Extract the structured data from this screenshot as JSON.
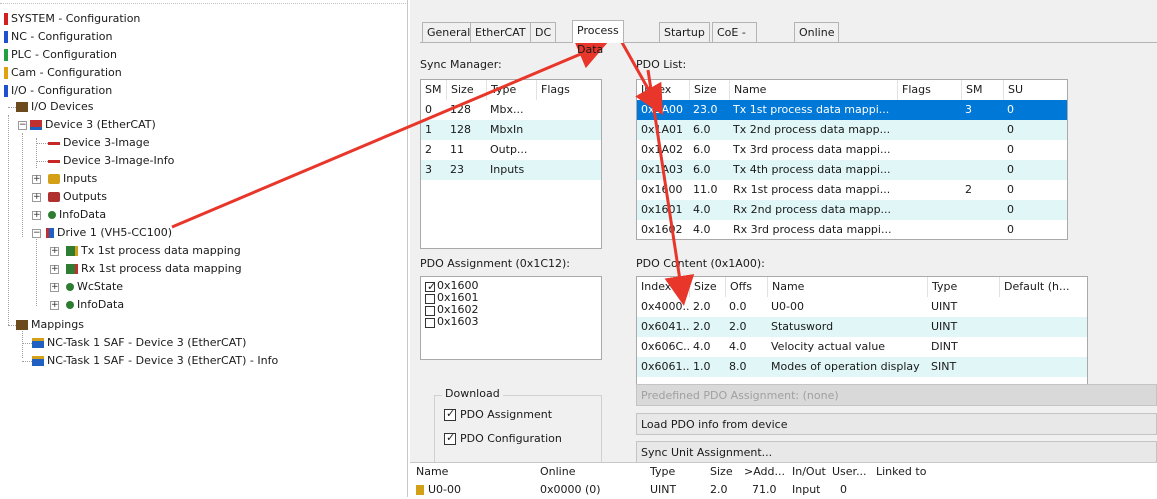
{
  "tree": {
    "items": [
      {
        "label": "SYSTEM - Configuration",
        "icon": "system-config-icon"
      },
      {
        "label": "NC - Configuration",
        "icon": "nc-config-icon"
      },
      {
        "label": "PLC - Configuration",
        "icon": "plc-config-icon"
      },
      {
        "label": "Cam - Configuration",
        "icon": "cam-config-icon"
      },
      {
        "label": "I/O - Configuration",
        "icon": "io-config-icon"
      },
      {
        "label": "I/O Devices",
        "icon": "io-devices-icon"
      },
      {
        "label": "Device 3 (EtherCAT)",
        "icon": "ethercat-device-icon"
      },
      {
        "label": "Device 3-Image",
        "icon": "image-icon"
      },
      {
        "label": "Device 3-Image-Info",
        "icon": "image-info-icon"
      },
      {
        "label": "Inputs",
        "icon": "inputs-icon"
      },
      {
        "label": "Outputs",
        "icon": "outputs-icon"
      },
      {
        "label": "InfoData",
        "icon": "infodata-icon"
      },
      {
        "label": "Drive 1 (VH5-CC100)",
        "icon": "drive-icon"
      },
      {
        "label": "Tx 1st  process data mapping",
        "icon": "tx-mapping-icon"
      },
      {
        "label": "Rx 1st process data mapping",
        "icon": "rx-mapping-icon"
      },
      {
        "label": "WcState",
        "icon": "wcstate-icon"
      },
      {
        "label": "InfoData",
        "icon": "infodata-icon"
      },
      {
        "label": "Mappings",
        "icon": "mappings-icon"
      },
      {
        "label": "NC-Task 1 SAF - Device 3 (EtherCAT)",
        "icon": "task-mapping-icon"
      },
      {
        "label": "NC-Task 1 SAF - Device 3 (EtherCAT) - Info",
        "icon": "task-mapping-icon"
      }
    ]
  },
  "tabs": [
    "General",
    "EtherCAT",
    "DC",
    "Process Data",
    "Startup",
    "CoE - Online",
    "Online"
  ],
  "active_tab": "Process Data",
  "sync_manager": {
    "title": "Sync Manager:",
    "columns": [
      "SM",
      "Size",
      "Type",
      "Flags"
    ],
    "rows": [
      [
        "0",
        "128",
        "Mbx...",
        ""
      ],
      [
        "1",
        "128",
        "MbxIn",
        ""
      ],
      [
        "2",
        "11",
        "Outp...",
        ""
      ],
      [
        "3",
        "23",
        "Inputs",
        ""
      ]
    ]
  },
  "pdo_list": {
    "title": "PDO List:",
    "columns": [
      "Index",
      "Size",
      "Name",
      "Flags",
      "SM",
      "SU"
    ],
    "rows": [
      [
        "0x1A00",
        "23.0",
        "Tx 1st  process data mappi...",
        "",
        "3",
        "0"
      ],
      [
        "0x1A01",
        "6.0",
        "Tx 2nd process data mapp...",
        "",
        "",
        "0"
      ],
      [
        "0x1A02",
        "6.0",
        "Tx 3rd process data mappi...",
        "",
        "",
        "0"
      ],
      [
        "0x1A03",
        "6.0",
        "Tx 4th process data mappi...",
        "",
        "",
        "0"
      ],
      [
        "0x1600",
        "11.0",
        "Rx 1st process data mappi...",
        "",
        "2",
        "0"
      ],
      [
        "0x1601",
        "4.0",
        "Rx 2nd process data mapp...",
        "",
        "",
        "0"
      ],
      [
        "0x1602",
        "4.0",
        "Rx 3rd process data mappi...",
        "",
        "",
        "0"
      ],
      [
        "0x1603",
        "4.0",
        "Rx 4th process data mappi...",
        "",
        "",
        "0"
      ]
    ]
  },
  "pdo_assignment": {
    "title": "PDO Assignment (0x1C12):",
    "items": [
      {
        "label": "0x1600",
        "checked": true
      },
      {
        "label": "0x1601",
        "checked": false
      },
      {
        "label": "0x1602",
        "checked": false
      },
      {
        "label": "0x1603",
        "checked": false
      }
    ]
  },
  "pdo_content": {
    "title": "PDO Content (0x1A00):",
    "columns": [
      "Index",
      "Size",
      "Offs",
      "Name",
      "Type",
      "Default (h..."
    ],
    "rows": [
      [
        "0x4000...",
        "2.0",
        "0.0",
        "U0-00",
        "UINT",
        ""
      ],
      [
        "0x6041...",
        "2.0",
        "2.0",
        "Statusword",
        "UINT",
        ""
      ],
      [
        "0x606C...",
        "4.0",
        "4.0",
        "Velocity actual value",
        "DINT",
        ""
      ],
      [
        "0x6061...",
        "1.0",
        "8.0",
        "Modes of operation display",
        "SINT",
        ""
      ]
    ]
  },
  "download": {
    "title": "Download",
    "pdo_assignment": "PDO Assignment",
    "pdo_configuration": "PDO Configuration"
  },
  "buttons": {
    "predefined": "Predefined PDO Assignment: (none)",
    "load_pdo": "Load PDO info from device",
    "sync_unit": "Sync Unit Assignment..."
  },
  "bottom_list": {
    "columns": [
      "Name",
      "Online",
      "Type",
      "Size",
      ">Add...",
      "In/Out",
      "User...",
      "Linked to"
    ],
    "row": [
      "U0-00",
      "0x0000 (0)",
      "UINT",
      "2.0",
      "71.0",
      "Input",
      "0",
      ""
    ]
  },
  "colors": {
    "selection": "#0078d7",
    "alt_row": "#e0f6f7",
    "annotation_arrow": "#e8362a"
  }
}
